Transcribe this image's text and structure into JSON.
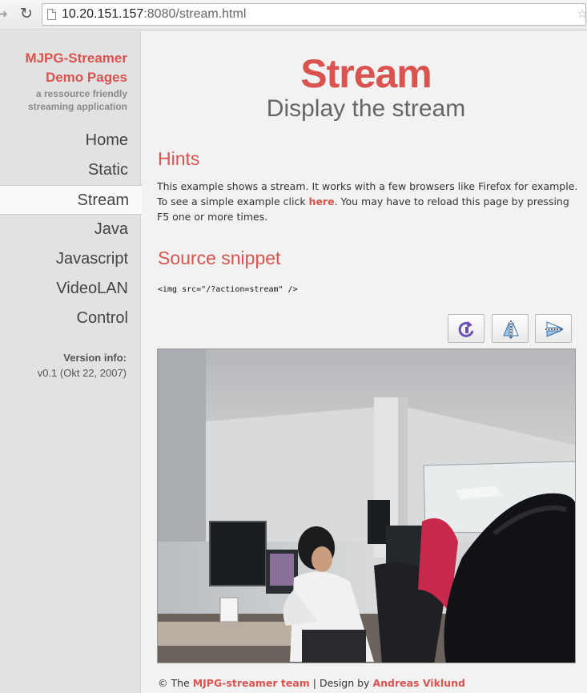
{
  "browser": {
    "url_host": "10.20.151.157",
    "url_rest": ":8080/stream.html"
  },
  "sidebar": {
    "brand_line1": "MJPG-Streamer",
    "brand_line2": "Demo Pages",
    "tagline_line1": "a ressource friendly",
    "tagline_line2": "streaming application",
    "nav": [
      {
        "label": "Home"
      },
      {
        "label": "Static"
      },
      {
        "label": "Stream",
        "active": true
      },
      {
        "label": "Java"
      },
      {
        "label": "Javascript"
      },
      {
        "label": "VideoLAN"
      },
      {
        "label": "Control"
      }
    ],
    "version_label": "Version info:",
    "version_value": "v0.1 (Okt 22, 2007)"
  },
  "main": {
    "title": "Stream",
    "subtitle": "Display the stream",
    "hints_title": "Hints",
    "hints_text_1": "This example shows a stream. It works with a few browsers like Firefox for example. To see a simple example click ",
    "hints_link": "here",
    "hints_text_2": ". You may have to reload this page by pressing F5 one or more times.",
    "snippet_title": "Source snippet",
    "snippet_code": "<img src=\"/?action=stream\" />",
    "buttons": [
      {
        "name": "rotate",
        "icon": "rotate-icon"
      },
      {
        "name": "flip-vertical",
        "icon": "flip-vertical-icon"
      },
      {
        "name": "flip-horizontal",
        "icon": "flip-horizontal-icon"
      }
    ]
  },
  "footer": {
    "prefix": "© The ",
    "team_link": "MJPG-streamer team",
    "separator": " | Design by ",
    "designer_link": "Andreas Viklund"
  },
  "colors": {
    "accent": "#d9534f",
    "sidebar_bg": "#e2e2e2",
    "content_bg": "#f2f2f2"
  }
}
